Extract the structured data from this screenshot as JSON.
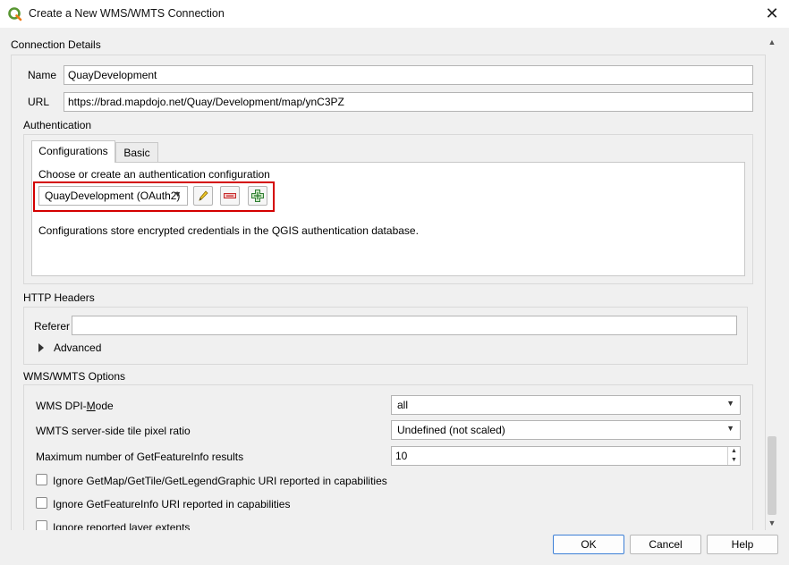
{
  "window": {
    "title": "Create a New WMS/WMTS Connection",
    "close_glyph": "✕",
    "app_icon": "qgis-logo-icon"
  },
  "connection": {
    "section_label": "Connection Details",
    "name_label": "Name",
    "name_value": "QuayDevelopment",
    "url_label": "URL",
    "url_value": "https://brad.mapdojo.net/Quay/Development/map/ynC3PZ"
  },
  "auth": {
    "section_label": "Authentication",
    "tabs": [
      {
        "label": "Configurations",
        "active": true
      },
      {
        "label": "Basic",
        "active": false
      }
    ],
    "choose_label": "Choose or create an authentication configuration",
    "config_selected": "QuayDevelopment (OAuth2)",
    "edit_icon": "pencil-icon",
    "remove_icon": "minus-icon",
    "add_icon": "plus-icon",
    "highlight_color": "#d40000",
    "info_text": "Configurations store encrypted credentials in the QGIS authentication database."
  },
  "http_headers": {
    "section_label": "HTTP Headers",
    "referer_label": "Referer",
    "referer_value": "",
    "advanced_label": "Advanced"
  },
  "wms_options": {
    "section_label": "WMS/WMTS Options",
    "dpi_label_pre": "WMS DPI-",
    "dpi_label_underlined": "M",
    "dpi_label_post": "ode",
    "dpi_value": "all",
    "tile_ratio_label": "WMTS server-side tile pixel ratio",
    "tile_ratio_value": "Undefined (not scaled)",
    "max_gfi_label": "Maximum number of GetFeatureInfo results",
    "max_gfi_value": "10",
    "checkboxes": [
      {
        "label": "Ignore GetMap/GetTile/GetLegendGraphic URI reported in capabilities",
        "checked": false
      },
      {
        "label": "Ignore GetFeatureInfo URI reported in capabilities",
        "checked": false
      },
      {
        "label": "Ignore reported layer extents",
        "checked": false
      }
    ]
  },
  "buttons": {
    "ok": "OK",
    "cancel": "Cancel",
    "help": "Help"
  }
}
